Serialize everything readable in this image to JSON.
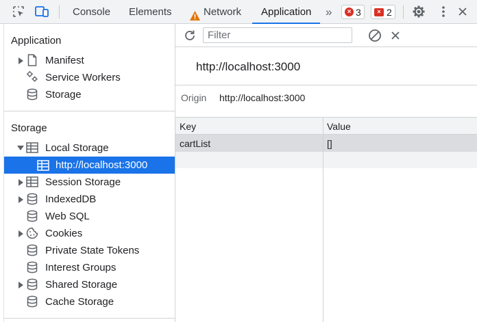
{
  "tabs": {
    "console": "Console",
    "elements": "Elements",
    "network": "Network",
    "application": "Application",
    "more": "»",
    "errors_count": "3",
    "issues_count": "2"
  },
  "sidebar": {
    "application_header": "Application",
    "application_items": [
      {
        "label": "Manifest",
        "icon": "document-icon"
      },
      {
        "label": "Service Workers",
        "icon": "gears-icon"
      },
      {
        "label": "Storage",
        "icon": "database-icon"
      }
    ],
    "storage_header": "Storage",
    "storage_items": [
      {
        "label": "Local Storage",
        "icon": "table-icon"
      },
      {
        "label": "http://localhost:3000",
        "icon": "table-icon"
      },
      {
        "label": "Session Storage",
        "icon": "table-icon"
      },
      {
        "label": "IndexedDB",
        "icon": "database-icon"
      },
      {
        "label": "Web SQL",
        "icon": "database-icon"
      },
      {
        "label": "Cookies",
        "icon": "cookie-icon"
      },
      {
        "label": "Private State Tokens",
        "icon": "database-icon"
      },
      {
        "label": "Interest Groups",
        "icon": "database-icon"
      },
      {
        "label": "Shared Storage",
        "icon": "database-icon"
      },
      {
        "label": "Cache Storage",
        "icon": "database-icon"
      }
    ]
  },
  "main": {
    "filter_placeholder": "Filter",
    "origin_title": "http://localhost:3000",
    "origin_label": "Origin",
    "origin_value": "http://localhost:3000",
    "columns": [
      "Key",
      "Value"
    ],
    "rows": [
      {
        "key": "cartList",
        "value": "[]"
      }
    ]
  },
  "colors": {
    "accent": "#1a73e8",
    "error": "#d93025",
    "warning": "#e37400"
  }
}
